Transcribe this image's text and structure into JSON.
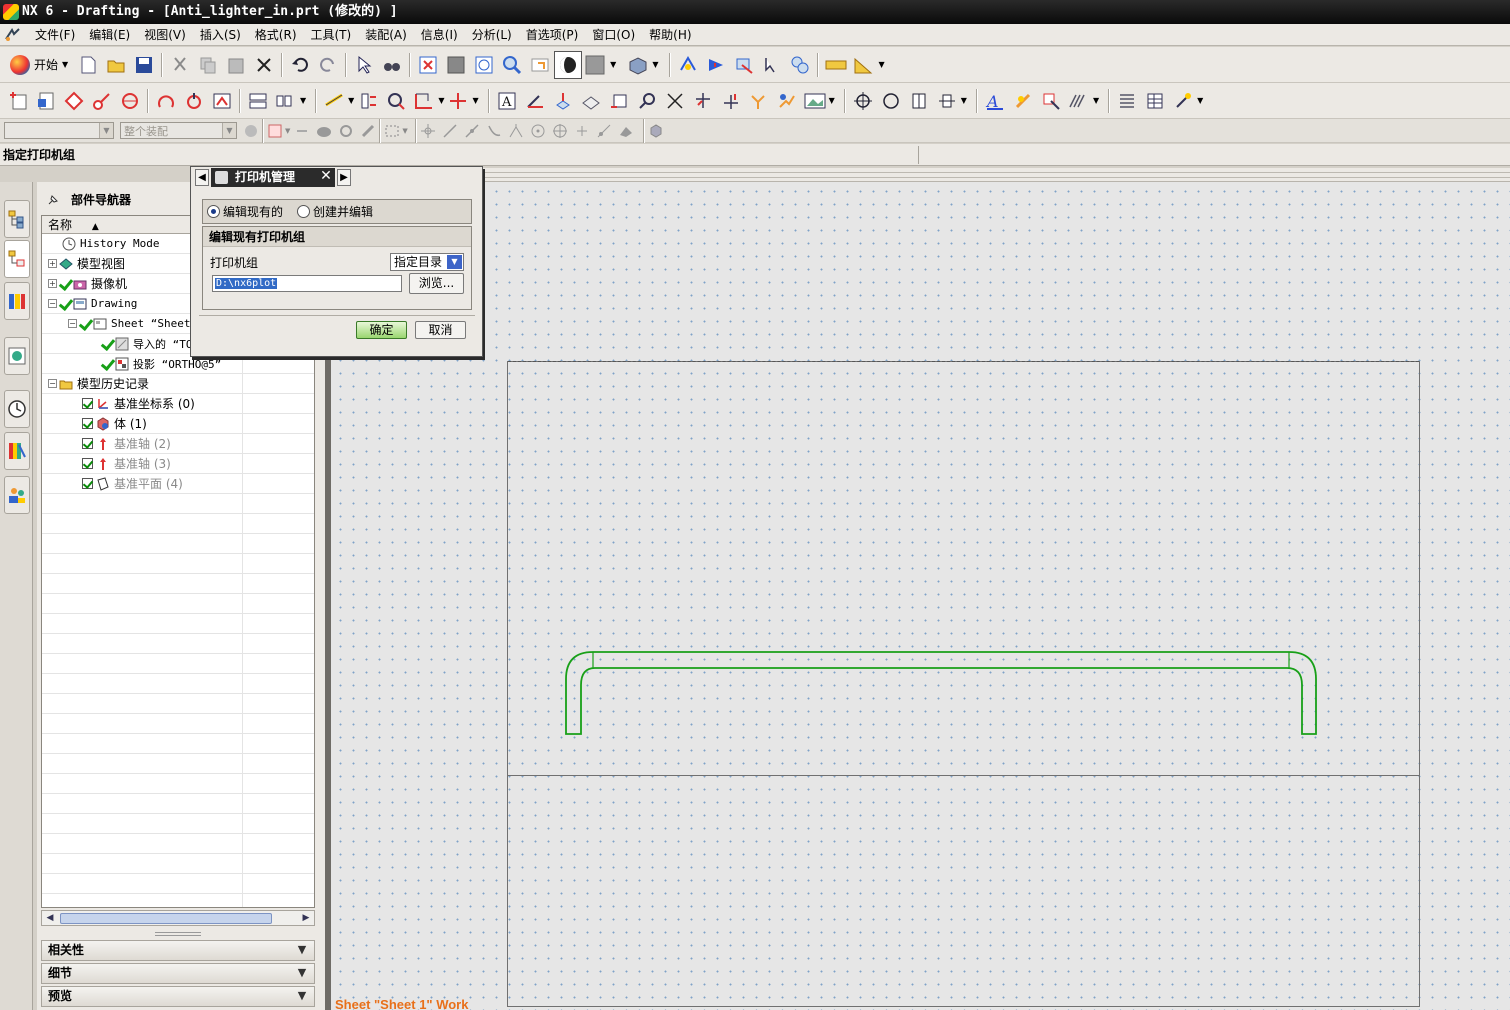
{
  "window": {
    "title": "NX 6 - Drafting - [Anti_lighter_in.prt  (修改的) ]"
  },
  "menu": [
    "文件(F)",
    "编辑(E)",
    "视图(V)",
    "插入(S)",
    "格式(R)",
    "工具(T)",
    "装配(A)",
    "信息(I)",
    "分析(L)",
    "首选项(P)",
    "窗口(O)",
    "帮助(H)"
  ],
  "toolbar": {
    "start_label": "开始"
  },
  "selection_bar": {
    "filter_value": "",
    "scope_value": "整个装配"
  },
  "cue_line": "指定打印机组",
  "navigator": {
    "title": "部件导航器",
    "column_name": "名称",
    "rows": [
      {
        "label": "History Mode",
        "dim": false
      },
      {
        "label": "模型视图",
        "dim": false
      },
      {
        "label": "摄像机",
        "dim": false
      },
      {
        "label": "Drawing",
        "dim": false
      },
      {
        "label": "Sheet “Sheet",
        "dim": false
      },
      {
        "label": "导入的 “TO",
        "dim": false
      },
      {
        "label": "投影 “ORTHO@5”",
        "dim": false
      },
      {
        "label": "模型历史记录",
        "dim": false
      },
      {
        "label": "基准坐标系  (0)",
        "dim": false
      },
      {
        "label": "体  (1)",
        "dim": false
      },
      {
        "label": "基准轴  (2)",
        "dim": true
      },
      {
        "label": "基准轴  (3)",
        "dim": true
      },
      {
        "label": "基准平面  (4)",
        "dim": true
      }
    ],
    "sections": [
      "相关性",
      "细节",
      "预览"
    ]
  },
  "dialog": {
    "title": "打印机管理",
    "radio_edit": "编辑现有的",
    "radio_create": "创建并编辑",
    "group_title": "编辑现有打印机组",
    "printer_group_label": "打印机组",
    "printer_group_value": "指定目录",
    "path_value": "D:\\nx6plot",
    "browse_label": "浏览...",
    "ok_label": "确定",
    "cancel_label": "取消"
  },
  "graphics": {
    "sheet_label": "Sheet \"Sheet 1\" Work"
  },
  "colors": {
    "geometry": "#18a018",
    "sheet_label": "#e8701a",
    "grid_dot": "#7fa2c8"
  }
}
